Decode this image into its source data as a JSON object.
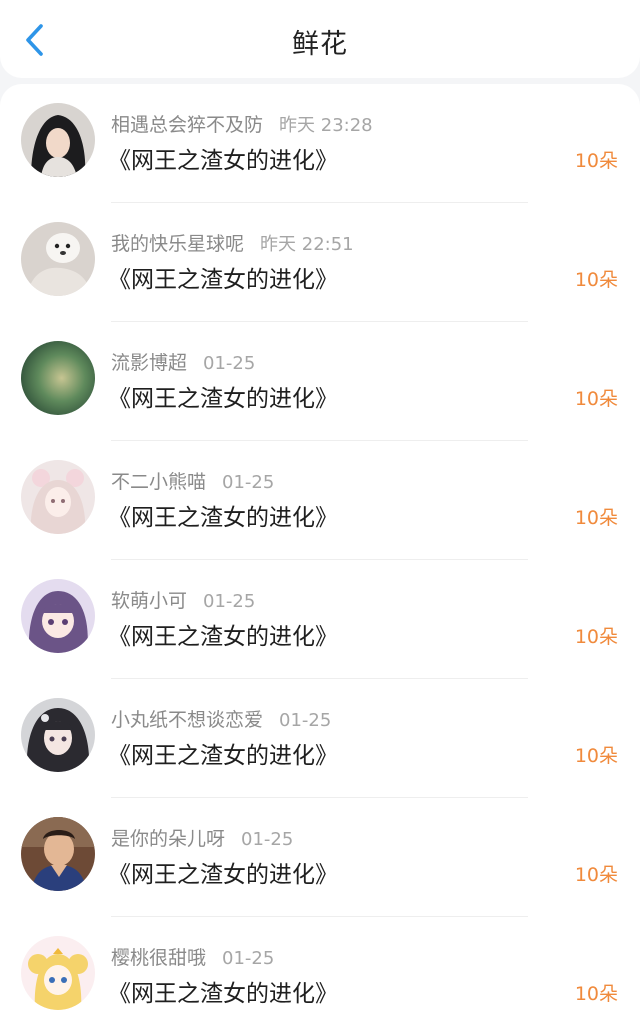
{
  "header": {
    "title": "鲜花",
    "back_icon": "chevron-left-icon",
    "accent_color": "#2e95e8"
  },
  "flowers": [
    {
      "user": "相遇总会猝不及防",
      "time": "昨天 23:28",
      "book": "《网王之渣女的进化》",
      "count": "10朵",
      "avatar_icon": "avatar-girl-covering-face"
    },
    {
      "user": "我的快乐星球呢",
      "time": "昨天 22:51",
      "book": "《网王之渣女的进化》",
      "count": "10朵",
      "avatar_icon": "avatar-dog-meme"
    },
    {
      "user": "流影博超",
      "time": "01-25",
      "book": "《网王之渣女的进化》",
      "count": "10朵",
      "avatar_icon": "avatar-green-blur-text"
    },
    {
      "user": "不二小熊喵",
      "time": "01-25",
      "book": "《网王之渣女的进化》",
      "count": "10朵",
      "avatar_icon": "avatar-anime-girl-pink"
    },
    {
      "user": "软萌小可",
      "time": "01-25",
      "book": "《网王之渣女的进化》",
      "count": "10朵",
      "avatar_icon": "avatar-anime-girl-purple"
    },
    {
      "user": "小丸纸不想谈恋爱",
      "time": "01-25",
      "book": "《网王之渣女的进化》",
      "count": "10朵",
      "avatar_icon": "avatar-anime-girl-dark"
    },
    {
      "user": "是你的朵儿呀",
      "time": "01-25",
      "book": "《网王之渣女的进化》",
      "count": "10朵",
      "avatar_icon": "avatar-boy-photo"
    },
    {
      "user": "樱桃很甜哦",
      "time": "01-25",
      "book": "《网王之渣女的进化》",
      "count": "10朵",
      "avatar_icon": "avatar-sailor-moon"
    }
  ],
  "colors": {
    "flower_count": "#f08a3c",
    "username": "#8a8a8a",
    "book_title": "#1f1f1f"
  }
}
